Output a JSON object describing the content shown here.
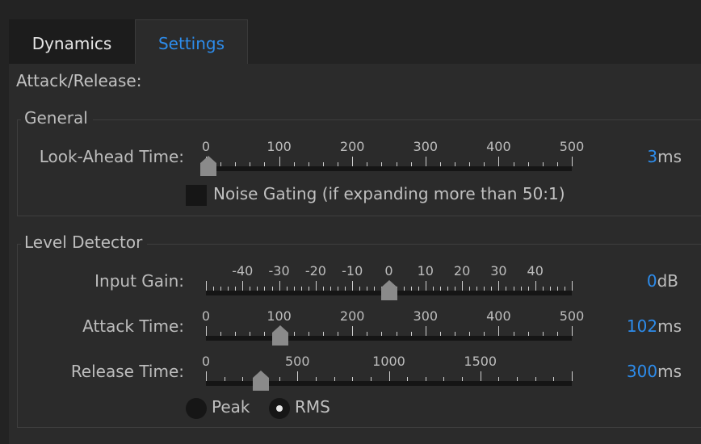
{
  "tabs": [
    {
      "label": "Dynamics",
      "active": false
    },
    {
      "label": "Settings",
      "active": true
    }
  ],
  "section_heading": "Attack/Release:",
  "general": {
    "title": "General",
    "look_ahead": {
      "label": "Look-Ahead Time:",
      "tick_labels": [
        "0",
        "100",
        "200",
        "300",
        "400",
        "500"
      ],
      "min": 0,
      "max": 500,
      "value": 3,
      "value_text": "3",
      "unit": "ms"
    },
    "noise_gating": {
      "label": "Noise Gating (if expanding more than 50:1)",
      "checked": false
    }
  },
  "level_detector": {
    "title": "Level Detector",
    "input_gain": {
      "label": "Input Gain:",
      "tick_labels": [
        "-40",
        "-30",
        "-20",
        "-10",
        "0",
        "10",
        "20",
        "30",
        "40"
      ],
      "min": -50,
      "max": 50,
      "value": 0,
      "value_text": "0",
      "unit": "dB"
    },
    "attack_time": {
      "label": "Attack Time:",
      "tick_labels": [
        "0",
        "100",
        "200",
        "300",
        "400",
        "500"
      ],
      "min": 0,
      "max": 500,
      "value": 102,
      "value_text": "102",
      "unit": "ms"
    },
    "release_time": {
      "label": "Release Time:",
      "tick_labels": [
        "0",
        "500",
        "1000",
        "1500"
      ],
      "min": 0,
      "max": 2000,
      "value": 300,
      "value_text": "300",
      "unit": "ms"
    },
    "detector_mode": {
      "options": [
        "Peak",
        "RMS"
      ],
      "selected": "RMS"
    }
  },
  "colors": {
    "accent": "#2d8ceb",
    "panel": "#2b2b2b",
    "track": "#151515",
    "thumb": "#8a8a8a"
  }
}
